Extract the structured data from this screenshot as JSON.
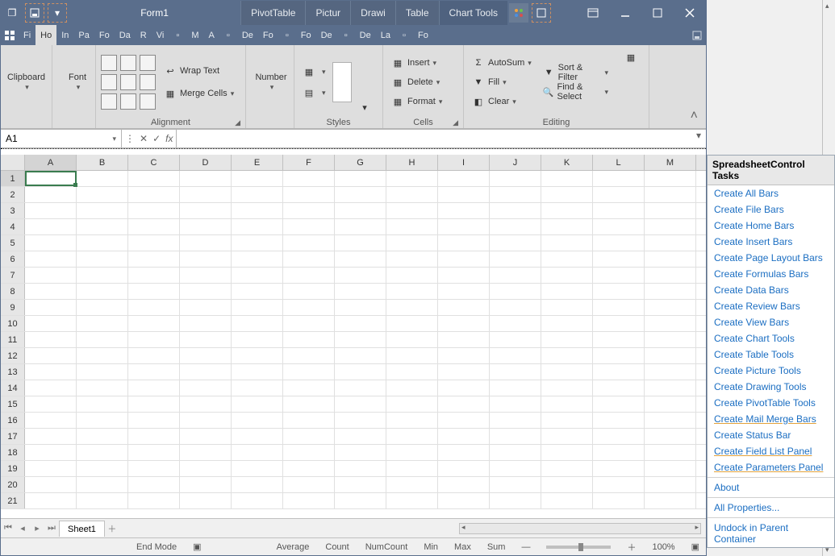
{
  "title": "Form1",
  "context_tabs": [
    "PivotTable",
    "Pictur",
    "Drawi",
    "Table",
    "Chart Tools"
  ],
  "ribbon_tabs": [
    "Fi",
    "In",
    "Pa",
    "Fo",
    "Da",
    "R",
    "Vi",
    "M",
    "A",
    "De",
    "Fo",
    "Fo",
    "De",
    "De",
    "La",
    "Fo"
  ],
  "active_tab": "Ho",
  "groups": {
    "clipboard": {
      "label": "Clipboard"
    },
    "font": {
      "label": "Font"
    },
    "alignment": {
      "label": "Alignment",
      "wrap": "Wrap Text",
      "merge": "Merge Cells"
    },
    "number": {
      "label": "Number"
    },
    "styles": {
      "label": "Styles"
    },
    "cells": {
      "label": "Cells",
      "insert": "Insert",
      "delete": "Delete",
      "format": "Format"
    },
    "editing": {
      "label": "Editing",
      "autosum": "AutoSum",
      "fill": "Fill",
      "clear": "Clear",
      "sort": "Sort & Filter",
      "find": "Find & Select"
    }
  },
  "namebox": "A1",
  "columns": [
    "A",
    "B",
    "C",
    "D",
    "E",
    "F",
    "G",
    "H",
    "I",
    "J",
    "K",
    "L",
    "M"
  ],
  "rows": [
    1,
    2,
    3,
    4,
    5,
    6,
    7,
    8,
    9,
    10,
    11,
    12,
    13,
    14,
    15,
    16,
    17,
    18,
    19,
    20,
    21
  ],
  "sheet": "Sheet1",
  "status": {
    "mode": "End Mode",
    "items": [
      "Average",
      "Count",
      "NumCount",
      "Min",
      "Max",
      "Sum"
    ],
    "zoom": "100%"
  },
  "tasks": {
    "title": "SpreadsheetControl Tasks",
    "links": [
      "Create All Bars",
      "Create File Bars",
      "Create Home Bars",
      "Create Insert Bars",
      "Create Page Layout Bars",
      "Create Formulas Bars",
      "Create Data Bars",
      "Create Review Bars",
      "Create View Bars",
      "Create Chart Tools",
      "Create Table Tools",
      "Create Picture Tools",
      "Create Drawing Tools",
      "Create PivotTable Tools",
      "Create Mail Merge Bars",
      "Create Status Bar",
      "Create Field List Panel",
      "Create Parameters Panel"
    ],
    "footer": [
      "About",
      "All Properties...",
      "Undock in Parent Container"
    ]
  }
}
